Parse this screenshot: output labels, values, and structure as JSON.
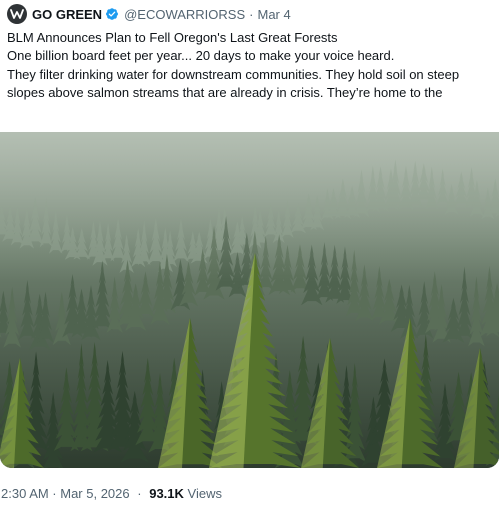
{
  "post": {
    "author_name": "GO GREEN",
    "handle": "@ECOWARRIORSS",
    "date": "Mar 4",
    "verified": true,
    "lines": [
      "BLM Announces Plan to Fell Oregon's Last Great Forests",
      "One billion board feet per year... 20 days to make your voice heard.",
      "They filter drinking water for downstream communities. They hold soil on steep slopes above salmon streams that are already in crisis. They’re home to the"
    ],
    "timestamp": "2:30 AM · Mar 5, 2026",
    "views_count": "93.1K",
    "views_label": "Views"
  },
  "colors": {
    "text_primary": "#0f1419",
    "text_secondary": "#536471",
    "verified_blue": "#1d9bf0"
  },
  "icons": {
    "avatar": "go-green-logo-icon",
    "verified": "verified-badge-icon"
  }
}
